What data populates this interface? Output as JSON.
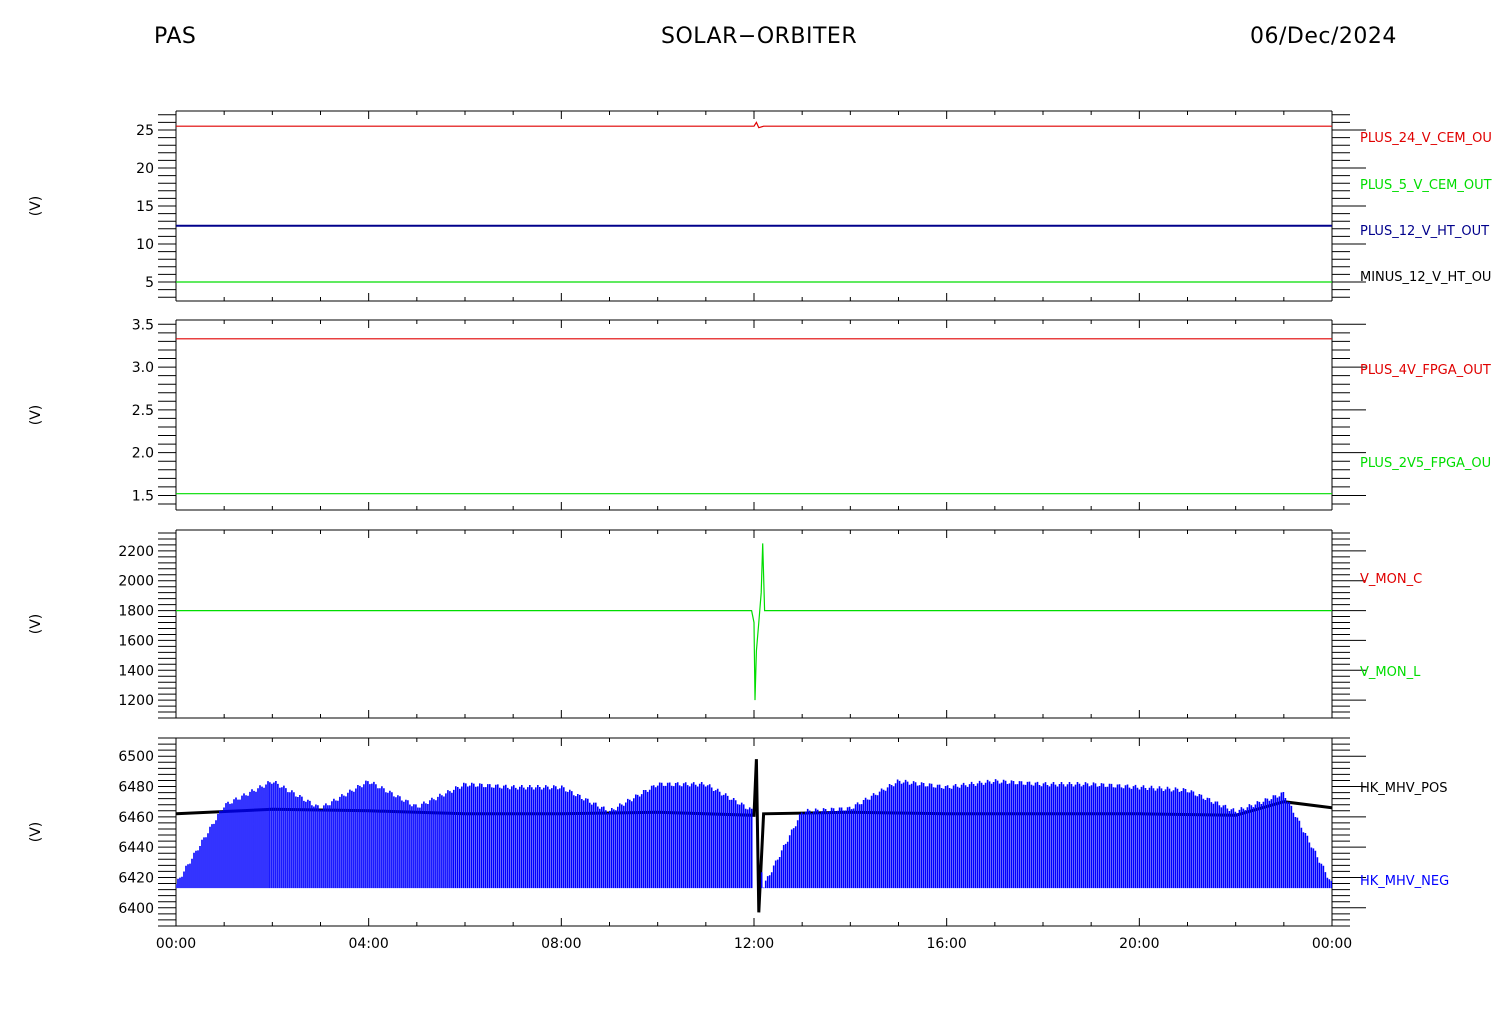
{
  "header": {
    "left": "PAS",
    "center": "SOLAR−ORBITER",
    "right": "06/Dec/2024"
  },
  "x_tick_labels": [
    "00:00",
    "04:00",
    "08:00",
    "12:00",
    "16:00",
    "20:00",
    "00:00"
  ],
  "colors": {
    "red": "#e00000",
    "green": "#00dd00",
    "navy": "#00008b",
    "blue": "#0000ff",
    "black": "#000000"
  },
  "chart_data": [
    {
      "type": "line",
      "ylabel": "(V)",
      "ylim": [
        2.5,
        27.5
      ],
      "yticks": [
        5,
        10,
        15,
        20,
        25
      ],
      "xlim": [
        "00:00",
        "24:00"
      ],
      "series": [
        {
          "name": "PLUS_24_V_CEM_OU",
          "color": "red",
          "values": [
            [
              0,
              25.5
            ],
            [
              12.0,
              25.5
            ],
            [
              12.05,
              26.0
            ],
            [
              12.1,
              25.3
            ],
            [
              12.2,
              25.5
            ],
            [
              24,
              25.5
            ]
          ]
        },
        {
          "name": "PLUS_5_V_CEM_OUT",
          "color": "green",
          "values": [
            [
              0,
              5.0
            ],
            [
              24,
              5.0
            ]
          ]
        },
        {
          "name": "PLUS_12_V_HT_OUT",
          "color": "navy",
          "values": [
            [
              0,
              12.4
            ],
            [
              24,
              12.4
            ]
          ]
        },
        {
          "name": "MINUS_12_V_HT_OU",
          "color": "black",
          "values": []
        }
      ]
    },
    {
      "type": "line",
      "ylabel": "(V)",
      "ylim": [
        1.33,
        3.55
      ],
      "yticks": [
        1.5,
        2.0,
        2.5,
        3.0,
        3.5
      ],
      "ytick_labels": [
        "1.5",
        "2.0",
        "2.5",
        "3.0",
        "3.5"
      ],
      "xlim": [
        "00:00",
        "24:00"
      ],
      "series": [
        {
          "name": "PLUS_4V_FPGA_OUT",
          "color": "red",
          "values": [
            [
              0,
              3.33
            ],
            [
              24,
              3.33
            ]
          ]
        },
        {
          "name": "PLUS_2V5_FPGA_OU",
          "color": "green",
          "values": [
            [
              0,
              1.52
            ],
            [
              24,
              1.52
            ]
          ]
        }
      ]
    },
    {
      "type": "line",
      "ylabel": "(V)",
      "ylim": [
        1080,
        2340
      ],
      "yticks": [
        1200,
        1400,
        1600,
        1800,
        2000,
        2200
      ],
      "xlim": [
        "00:00",
        "24:00"
      ],
      "series": [
        {
          "name": "V_MON_C",
          "color": "red",
          "values": []
        },
        {
          "name": "V_MON_L",
          "color": "green",
          "values": [
            [
              0,
              1800
            ],
            [
              11.95,
              1800
            ],
            [
              12.0,
              1720
            ],
            [
              12.02,
              1200
            ],
            [
              12.05,
              1530
            ],
            [
              12.1,
              1720
            ],
            [
              12.15,
              1920
            ],
            [
              12.18,
              2250
            ],
            [
              12.22,
              1800
            ],
            [
              24,
              1800
            ]
          ]
        }
      ]
    },
    {
      "type": "line",
      "ylabel": "(V)",
      "ylim": [
        6388,
        6512
      ],
      "yticks": [
        6400,
        6420,
        6440,
        6460,
        6480,
        6500
      ],
      "xlim": [
        "00:00",
        "24:00"
      ],
      "series": [
        {
          "name": "HK_MHV_POS",
          "color": "black",
          "values": [
            [
              0,
              6462
            ],
            [
              2,
              6465
            ],
            [
              4,
              6464
            ],
            [
              6,
              6462
            ],
            [
              8,
              6462
            ],
            [
              10,
              6463
            ],
            [
              12,
              6461
            ],
            [
              12.05,
              6498
            ],
            [
              12.1,
              6397
            ],
            [
              12.2,
              6462
            ],
            [
              14,
              6463
            ],
            [
              16,
              6462
            ],
            [
              18,
              6462
            ],
            [
              20,
              6462
            ],
            [
              22,
              6461
            ],
            [
              23,
              6470
            ],
            [
              24,
              6466
            ]
          ]
        },
        {
          "name": "HK_MHV_NEG",
          "color": "blue",
          "values": [
            [
              0,
              6414
            ],
            [
              1,
              6466
            ],
            [
              2,
              6482
            ],
            [
              3,
              6464
            ],
            [
              4,
              6482
            ],
            [
              5,
              6465
            ],
            [
              6,
              6480
            ],
            [
              7,
              6478
            ],
            [
              8,
              6478
            ],
            [
              9,
              6462
            ],
            [
              10,
              6480
            ],
            [
              11,
              6480
            ],
            [
              12,
              6462
            ],
            [
              12.2,
              6413
            ],
            [
              13,
              6462
            ],
            [
              14,
              6464
            ],
            [
              15,
              6482
            ],
            [
              16,
              6478
            ],
            [
              17,
              6482
            ],
            [
              18,
              6480
            ],
            [
              19,
              6480
            ],
            [
              20,
              6478
            ],
            [
              21,
              6476
            ],
            [
              22,
              6462
            ],
            [
              23,
              6474
            ],
            [
              24,
              6414
            ]
          ]
        }
      ]
    }
  ]
}
